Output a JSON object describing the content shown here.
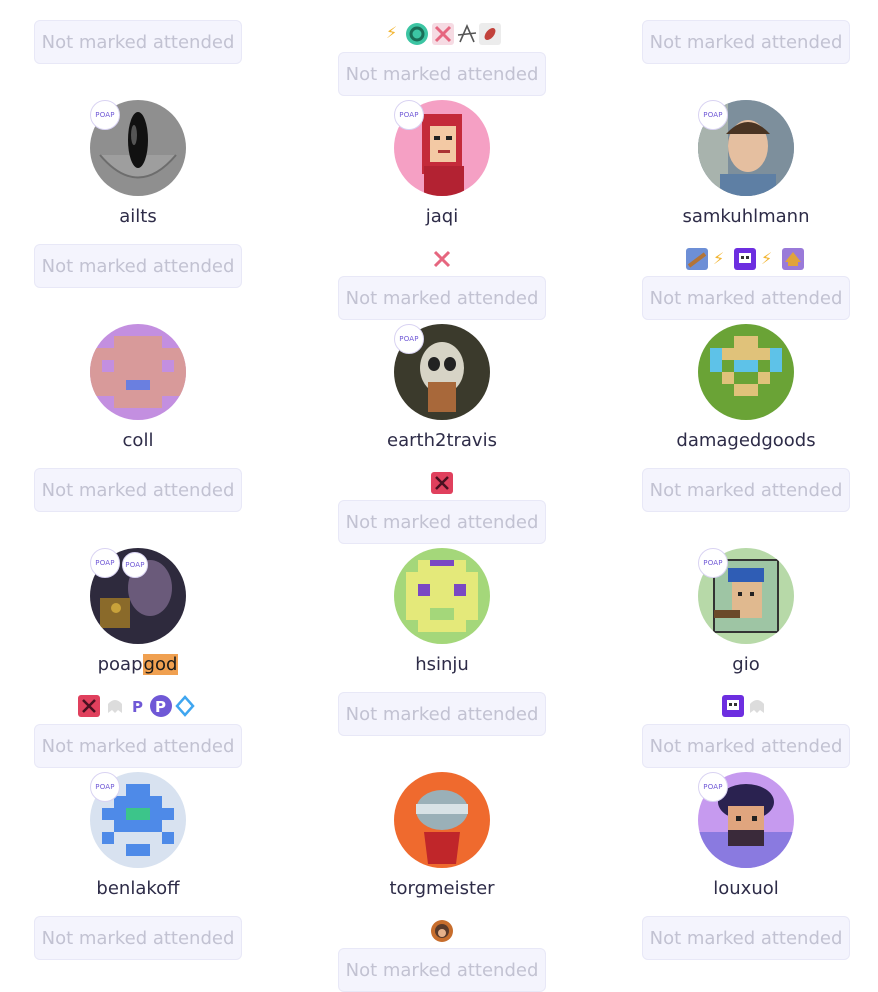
{
  "status_label": "Not marked attended",
  "poap_label": "POAP",
  "users": [
    {
      "name": "ailts"
    },
    {
      "name": "jaqi"
    },
    {
      "name": "samkuhlmann"
    },
    {
      "name": "coll"
    },
    {
      "name": "earth2travis"
    },
    {
      "name": "damagedgoods"
    },
    {
      "name": "poap",
      "name_highlight": "god"
    },
    {
      "name": "hsinju"
    },
    {
      "name": "gio"
    },
    {
      "name": "benlakoff"
    },
    {
      "name": "torgmeister"
    },
    {
      "name": "louxuol"
    }
  ],
  "colors": {
    "button_bg": "#f4f4fd",
    "button_text": "#c2c2d2",
    "poap_purple": "#6f58d6",
    "highlight": "#f0a050"
  }
}
